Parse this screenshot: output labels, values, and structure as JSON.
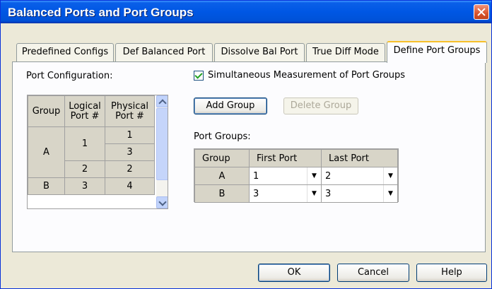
{
  "window": {
    "title": "Balanced Ports and Port Groups"
  },
  "tabs": [
    {
      "label": "Predefined Configs"
    },
    {
      "label": "Def Balanced Port"
    },
    {
      "label": "Dissolve Bal Port"
    },
    {
      "label": "True Diff Mode"
    },
    {
      "label": "Define Port Groups",
      "active": true
    }
  ],
  "port_configuration": {
    "label": "Port Configuration:",
    "headers": {
      "group": "Group",
      "logical": "Logical Port #",
      "physical": "Physical Port #"
    },
    "rows": [
      {
        "group": "A",
        "logical": "1",
        "physical": [
          "1",
          "3"
        ]
      },
      {
        "group": "A",
        "logical": "2",
        "physical": [
          "2"
        ]
      },
      {
        "group": "B",
        "logical": "3",
        "physical": [
          "4"
        ]
      }
    ]
  },
  "simultaneous": {
    "label": "Simultaneous Measurement of Port Groups",
    "checked": true
  },
  "buttons": {
    "add_group": "Add Group",
    "delete_group": "Delete Group",
    "ok": "OK",
    "cancel": "Cancel",
    "help": "Help"
  },
  "port_groups": {
    "label": "Port Groups:",
    "headers": {
      "group": "Group",
      "first": "First Port",
      "last": "Last Port"
    },
    "rows": [
      {
        "group": "A",
        "first": "1",
        "last": "2"
      },
      {
        "group": "B",
        "first": "3",
        "last": "3"
      }
    ]
  },
  "colors": {
    "titlebar": "#0057e4",
    "dialog_bg": "#ece9d8",
    "active_tab_accent": "#f7c02a",
    "close_button": "#d9542c"
  }
}
